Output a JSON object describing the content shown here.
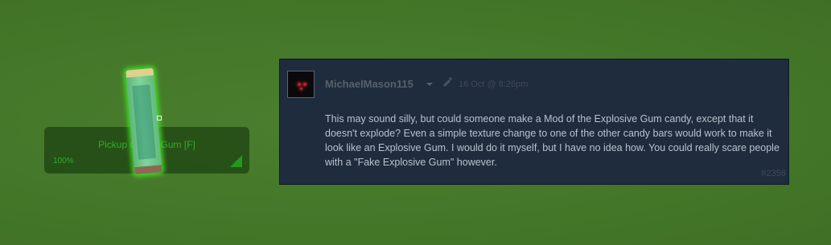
{
  "game": {
    "pickup_label": "Pickup Candy Gum [F]",
    "pickup_percent": "100%",
    "item_icon": "candy-gum-item",
    "glow_color": "#46e628"
  },
  "comment": {
    "avatar_icon": "dark-avatar-icon",
    "username": "MichaelMason115",
    "dropdown_icon": "chevron-down-icon",
    "edited_icon": "edit-icon",
    "timestamp": "16 Oct @ 8:26pm",
    "text": "This may sound silly, but could someone make a Mod of the Explosive Gum candy, except that it doesn't explode? Even a simple texture change to one of the other candy bars would work to make it look like an Explosive Gum. I would do it myself, but I have no idea how. You could really scare people with a \"Fake Explosive Gum\" however.",
    "number": "#2356"
  }
}
